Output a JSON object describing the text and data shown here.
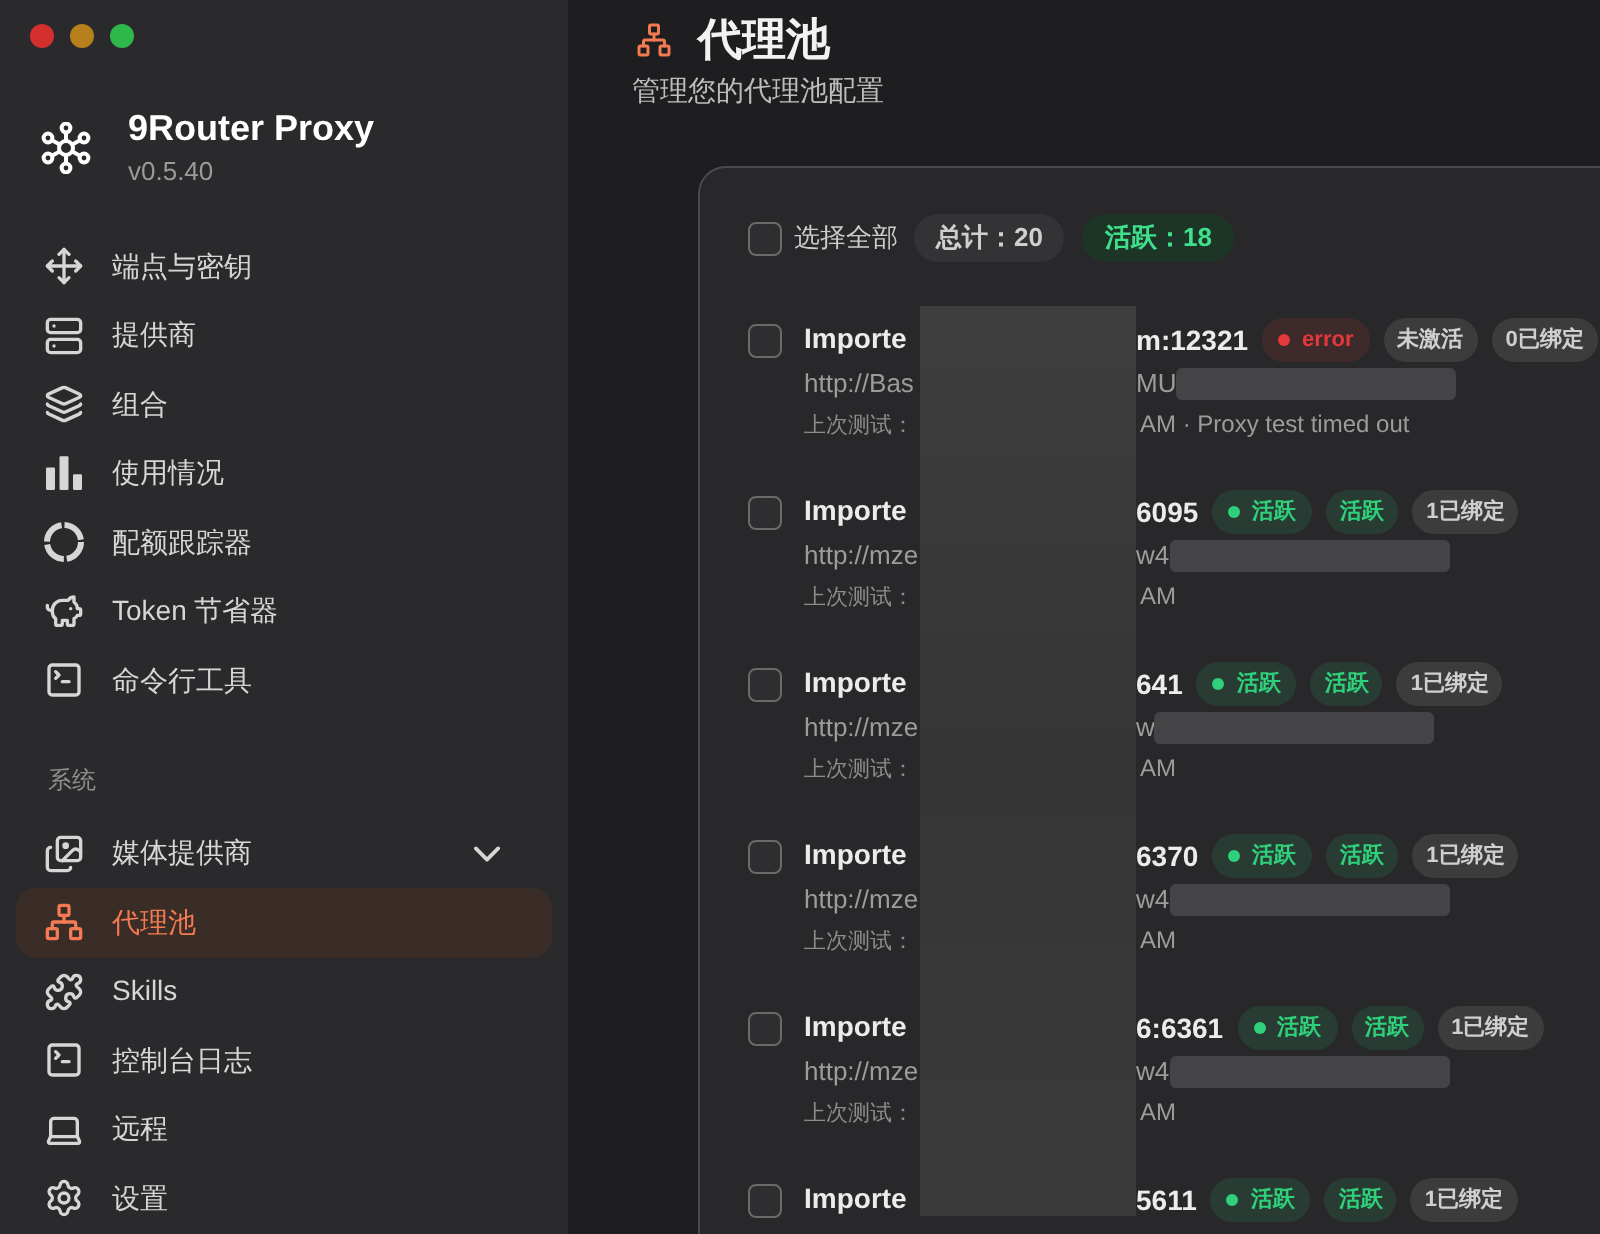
{
  "app": {
    "name": "9Router Proxy",
    "version": "v0.5.40"
  },
  "sidebar": {
    "items": [
      {
        "label": "端点与密钥",
        "selected": false
      },
      {
        "label": "提供商",
        "selected": false
      },
      {
        "label": "组合",
        "selected": false
      },
      {
        "label": "使用情况",
        "selected": false
      },
      {
        "label": "配额跟踪器",
        "selected": false
      },
      {
        "label": "Token 节省器",
        "selected": false
      },
      {
        "label": "命令行工具",
        "selected": false
      }
    ],
    "section": {
      "title": "系统",
      "items": [
        {
          "label": "媒体提供商",
          "selected": false,
          "expanded": false
        },
        {
          "label": "代理池",
          "selected": true
        },
        {
          "label": "Skills",
          "selected": false
        },
        {
          "label": "控制台日志",
          "selected": false
        },
        {
          "label": "远程",
          "selected": false
        },
        {
          "label": "设置",
          "selected": false
        }
      ]
    }
  },
  "page": {
    "title": "代理池",
    "subtitle": "管理您的代理池配置"
  },
  "toolbar": {
    "select_all": {
      "label": "选择全部",
      "checked": false
    },
    "total": "总计：20",
    "active": "活跃：18"
  },
  "proxies": [
    {
      "checked": false,
      "name_start": "Importe",
      "name_end": "m:12321",
      "badges": [
        {
          "kind": "status",
          "color": "#e5383b",
          "label": "error"
        },
        {
          "kind": "plain",
          "color": "#cfcfcf",
          "label": "未激活"
        },
        {
          "kind": "plain",
          "color": "#cfcfcf",
          "label": "0已绑定"
        }
      ],
      "url_start": "http://Bas",
      "url_end": "MU",
      "test_label": "上次测试：",
      "test_result": "AM · Proxy test timed out"
    },
    {
      "checked": false,
      "name_start": "Importe",
      "name_end": "6095",
      "badges": [
        {
          "kind": "status",
          "color": "#2fd07a",
          "label": "活跃"
        },
        {
          "kind": "plain",
          "color": "#2fd07a",
          "label": "活跃"
        },
        {
          "kind": "plain",
          "color": "#cfcfcf",
          "label": "1已绑定"
        }
      ],
      "url_start": "http://mze",
      "url_end": "w4",
      "test_label": "上次测试：",
      "test_result": "AM"
    },
    {
      "checked": false,
      "name_start": "Importe",
      "name_end": "641",
      "badges": [
        {
          "kind": "status",
          "color": "#2fd07a",
          "label": "活跃"
        },
        {
          "kind": "plain",
          "color": "#2fd07a",
          "label": "活跃"
        },
        {
          "kind": "plain",
          "color": "#cfcfcf",
          "label": "1已绑定"
        }
      ],
      "url_start": "http://mze",
      "url_end": "w",
      "test_label": "上次测试：",
      "test_result": "AM"
    },
    {
      "checked": false,
      "name_start": "Importe",
      "name_end": "6370",
      "badges": [
        {
          "kind": "status",
          "color": "#2fd07a",
          "label": "活跃"
        },
        {
          "kind": "plain",
          "color": "#2fd07a",
          "label": "活跃"
        },
        {
          "kind": "plain",
          "color": "#cfcfcf",
          "label": "1已绑定"
        }
      ],
      "url_start": "http://mze",
      "url_end": "w4",
      "test_label": "上次测试：",
      "test_result": "AM"
    },
    {
      "checked": false,
      "name_start": "Importe",
      "name_end": "6:6361",
      "badges": [
        {
          "kind": "status",
          "color": "#2fd07a",
          "label": "活跃"
        },
        {
          "kind": "plain",
          "color": "#2fd07a",
          "label": "活跃"
        },
        {
          "kind": "plain",
          "color": "#cfcfcf",
          "label": "1已绑定"
        }
      ],
      "url_start": "http://mze",
      "url_end": "w4",
      "test_label": "上次测试：",
      "test_result": "AM"
    },
    {
      "checked": false,
      "name_start": "Importe",
      "name_end": "5611",
      "badges": [
        {
          "kind": "status",
          "color": "#2fd07a",
          "label": "活跃"
        },
        {
          "kind": "plain",
          "color": "#2fd07a",
          "label": "活跃"
        },
        {
          "kind": "plain",
          "color": "#cfcfcf",
          "label": "1已绑定"
        }
      ]
    }
  ]
}
